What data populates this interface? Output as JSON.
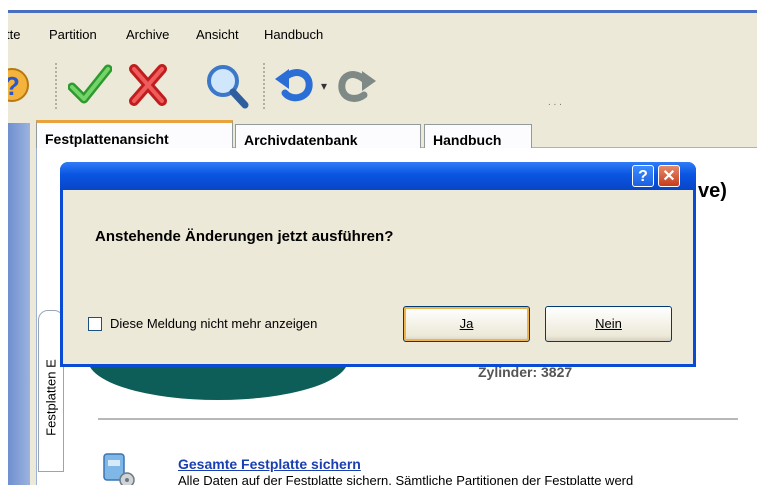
{
  "menubar": {
    "items": [
      "tte",
      "Partition",
      "Archive",
      "Ansicht",
      "Handbuch"
    ]
  },
  "toolbar": {
    "buttons": [
      "help-icon",
      "apply-check-icon",
      "discard-x-icon",
      "search-icon",
      "undo-icon",
      "redo-icon"
    ],
    "dots": ". . ."
  },
  "tabs": {
    "items": [
      "Festplattenansicht",
      "Archivdatenbank",
      "Handbuch"
    ],
    "active": "Festplattenansicht"
  },
  "side_tab": {
    "label": "Festplatten E"
  },
  "background": {
    "peek_text": "ve)",
    "cylinder_text": "Zylinder:  3827",
    "action_title": "Gesamte Festplatte sichern",
    "action_desc": "Alle Daten auf der Festplatte sichern. Sämtliche Partitionen der Festplatte werd"
  },
  "dialog": {
    "title": "",
    "help_btn": "?",
    "close_btn": "✕",
    "question": "Anstehende Änderungen jetzt ausführen?",
    "checkbox_label": "Diese Meldung nicht mehr anzeigen",
    "checkbox_checked": false,
    "yes_label": "Ja",
    "no_label": "Nein"
  },
  "colors": {
    "titlebar": "#0a55e2",
    "disk": "#0d5e59",
    "link": "#1a3fb0",
    "tab_highlight": "#e8a33c"
  }
}
